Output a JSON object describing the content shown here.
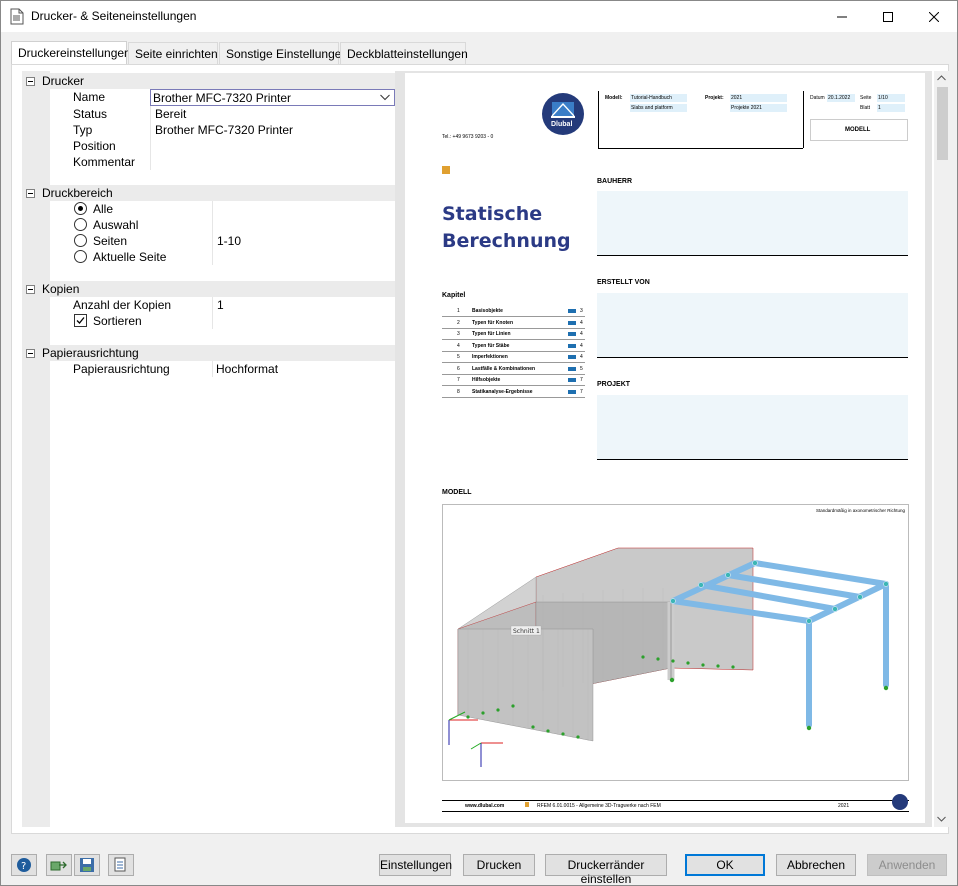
{
  "window": {
    "title": "Drucker- & Seiteneinstellungen"
  },
  "tabs": [
    "Druckereinstellungen",
    "Seite einrichten",
    "Sonstige Einstellungen",
    "Deckblatteinstellungen"
  ],
  "printer": {
    "category": "Drucker",
    "name_label": "Name",
    "name_value": "Brother MFC-7320 Printer",
    "status_label": "Status",
    "status_value": "Bereit",
    "type_label": "Typ",
    "type_value": "Brother MFC-7320 Printer",
    "position_label": "Position",
    "comment_label": "Kommentar"
  },
  "range": {
    "category": "Druckbereich",
    "all": "Alle",
    "selection": "Auswahl",
    "pages": "Seiten",
    "pages_value": "1-10",
    "current": "Aktuelle Seite"
  },
  "copies": {
    "category": "Kopien",
    "count_label": "Anzahl der Kopien",
    "count_value": "1",
    "sort_label": "Sortieren"
  },
  "orientation": {
    "category": "Papierausrichtung",
    "label": "Papierausrichtung",
    "value": "Hochformat"
  },
  "preview": {
    "phone": "Tel.: +49 9673 9203 - 0",
    "modell_label": "Modell:",
    "modell_value": "Tutorial-Handbuch",
    "modell_sub": "Slabs and platform",
    "projekt_label": "Projekt:",
    "projekt_value": "2021",
    "projekt_sub": "Projekte 2021",
    "datum_label": "Datum",
    "datum_value": "20.1.2022",
    "seite_label": "Seite",
    "seite_value": "1/10",
    "blatt_label": "Blatt",
    "blatt_value": "1",
    "box_title": "MODELL",
    "title_line1": "Statische",
    "title_line2": "Berechnung",
    "bauherr": "BAUHERR",
    "erstellt": "ERSTELLT VON",
    "projekt": "PROJEKT",
    "kapitel": "Kapitel",
    "chapters": [
      {
        "n": "1",
        "t": "Basisobjekte",
        "p": "3"
      },
      {
        "n": "2",
        "t": "Typen für Knoten",
        "p": "4"
      },
      {
        "n": "3",
        "t": "Typen für Linien",
        "p": "4"
      },
      {
        "n": "4",
        "t": "Typen für Stäbe",
        "p": "4"
      },
      {
        "n": "5",
        "t": "Imperfektionen",
        "p": "4"
      },
      {
        "n": "6",
        "t": "Lastfälle & Kombinationen",
        "p": "5"
      },
      {
        "n": "7",
        "t": "Hilfsobjekte",
        "p": "7"
      },
      {
        "n": "8",
        "t": "Statikanalyse-Ergebnisse",
        "p": "7"
      }
    ],
    "model_heading": "MODELL",
    "view_caption": "Standardmäßig in axonometrischer Richtung",
    "section_label": "Schnitt 1",
    "footer_url": "www.dlubal.com",
    "footer_text": "RFEM 6.01.0015 - Allgemeine 3D-Tragwerke nach FEM",
    "footer_year": "2021",
    "logo_text": "Dlubal"
  },
  "buttons": {
    "settings": "Einstellungen",
    "print": "Drucken",
    "margins": "Druckerränder einstellen",
    "ok": "OK",
    "cancel": "Abbrechen",
    "apply": "Anwenden"
  }
}
